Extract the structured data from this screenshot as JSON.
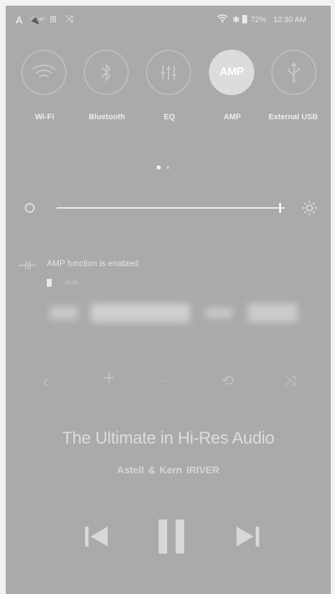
{
  "status_bar": {
    "letter": "A",
    "usb": "🔌⁸⁰",
    "grid": "⊞",
    "shuffle": "⤨",
    "wifi_icon": "wifi-icon",
    "bluetooth": "✱",
    "battery": "72%",
    "time": "12:30 AM"
  },
  "toggles": [
    {
      "label": "Wi-Fi",
      "icon": "wifi-icon",
      "active": false
    },
    {
      "label": "Bluetooth",
      "icon": "bluetooth-icon",
      "active": false
    },
    {
      "label": "EQ",
      "icon": "eq-icon",
      "active": false
    },
    {
      "label": "AMP",
      "icon_text": "AMP",
      "active": true
    },
    {
      "label": "External USB",
      "icon": "usb-icon",
      "active": false
    }
  ],
  "brightness": {
    "level": 0.98
  },
  "notification": {
    "text": "AMP function is enabled",
    "sub_text": "ents"
  },
  "controls": {
    "back": "‹",
    "add": "+",
    "more": "···",
    "repeat": "⟲",
    "shuffle": "⤨"
  },
  "song": {
    "title": "The Ultimate in Hi-Res Audio",
    "artist": "Astell & Kern   IRIVER"
  },
  "colors": {
    "screen_bg": "#a9abab",
    "text": "#e8e8e8",
    "active_toggle": "#dcdcdc"
  }
}
